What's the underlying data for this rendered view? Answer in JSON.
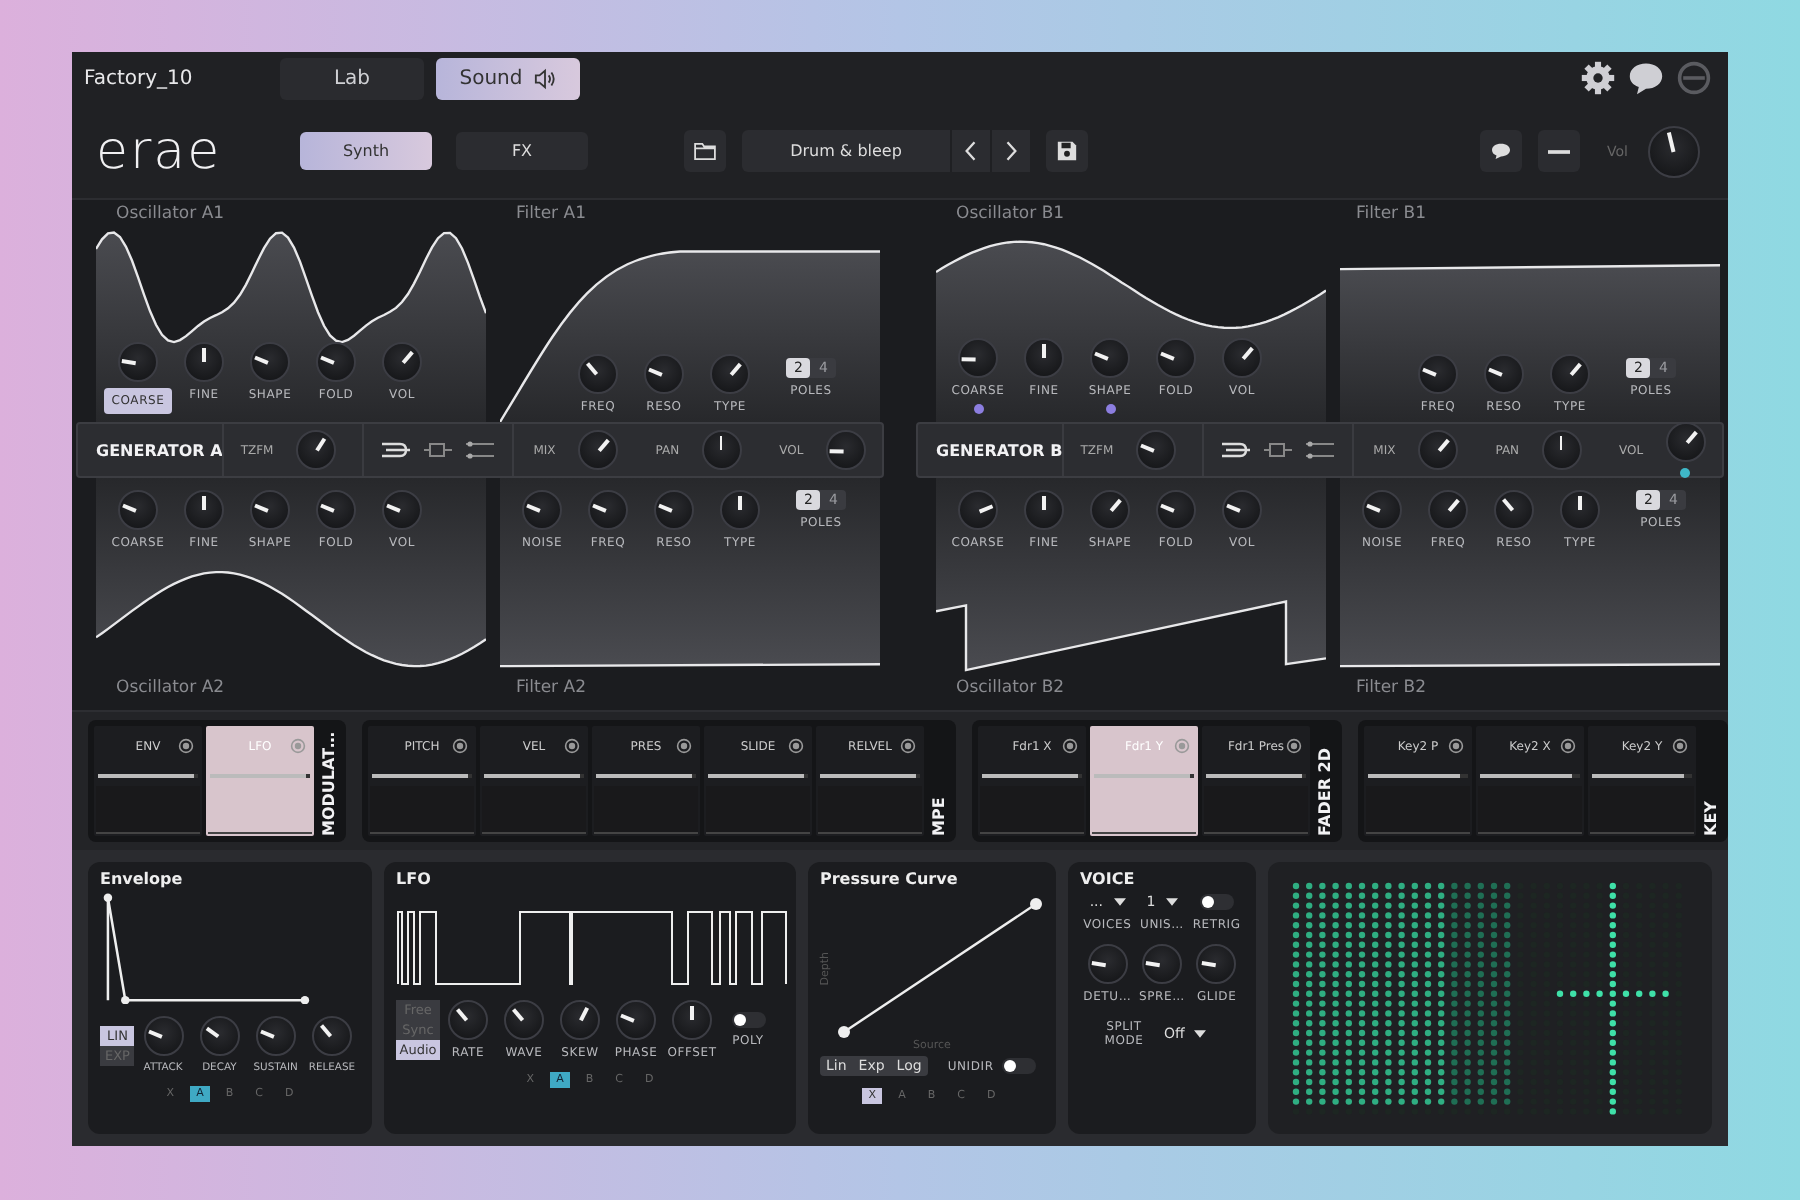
{
  "header": {
    "preset_name": "Factory_10",
    "tabs": [
      {
        "label": "Lab",
        "selected": false
      },
      {
        "label": "Sound",
        "selected": true
      }
    ]
  },
  "toolbar": {
    "logo": "erae",
    "modes": [
      {
        "label": "Synth",
        "selected": true
      },
      {
        "label": "FX",
        "selected": false
      }
    ],
    "preset": "Drum & bleep",
    "vol": {
      "label": "Vol",
      "level": 0.45
    }
  },
  "generators": [
    {
      "name": "GENERATOR A",
      "osc_top": {
        "title": "Oscillator A1",
        "knobs": [
          {
            "label": "COARSE",
            "level": 0.2,
            "selected": true
          },
          {
            "label": "FINE",
            "level": 0.5,
            "selected": false
          },
          {
            "label": "SHAPE",
            "level": 0.25,
            "selected": false
          },
          {
            "label": "FOLD",
            "level": 0.25,
            "selected": false
          },
          {
            "label": "VOL",
            "level": 0.65,
            "selected": false
          }
        ]
      },
      "filter_top": {
        "title": "Filter A1",
        "knobs": [
          {
            "label": "FREQ",
            "level": 0.35
          },
          {
            "label": "RESO",
            "level": 0.25
          },
          {
            "label": "TYPE",
            "level": 0.65
          }
        ],
        "poles": [
          {
            "label": "2",
            "selected": true
          },
          {
            "label": "4",
            "selected": false
          }
        ],
        "poles_label": "POLES"
      },
      "tzfm": {
        "label": "TZFM",
        "level": 0.62
      },
      "mix_knobs": [
        {
          "label": "MIX",
          "level": 0.65
        },
        {
          "label": "PAN",
          "level": 0.5
        },
        {
          "label": "VOL",
          "level": 0.17
        }
      ],
      "osc_bottom": {
        "title": "Oscillator A2",
        "knobs": [
          {
            "label": "COARSE",
            "level": 0.25,
            "selected": false
          },
          {
            "label": "FINE",
            "level": 0.5,
            "selected": false
          },
          {
            "label": "SHAPE",
            "level": 0.25,
            "selected": false
          },
          {
            "label": "FOLD",
            "level": 0.25,
            "selected": false
          },
          {
            "label": "VOL",
            "level": 0.25,
            "selected": false
          }
        ]
      },
      "filter_bottom": {
        "title": "Filter A2",
        "knobs": [
          {
            "label": "NOISE",
            "level": 0.25
          },
          {
            "label": "FREQ",
            "level": 0.25
          },
          {
            "label": "RESO",
            "level": 0.25
          },
          {
            "label": "TYPE",
            "level": 0.5
          }
        ],
        "poles": [
          {
            "label": "2",
            "selected": true
          },
          {
            "label": "4",
            "selected": false
          }
        ],
        "poles_label": "POLES"
      }
    },
    {
      "name": "GENERATOR B",
      "osc_top": {
        "title": "Oscillator B1",
        "knobs": [
          {
            "label": "COARSE",
            "level": 0.17,
            "selected": false,
            "color": "#8c7ee0"
          },
          {
            "label": "FINE",
            "level": 0.5,
            "selected": false
          },
          {
            "label": "SHAPE",
            "level": 0.25,
            "selected": false,
            "color": "#8c7ee0"
          },
          {
            "label": "FOLD",
            "level": 0.25,
            "selected": false
          },
          {
            "label": "VOL",
            "level": 0.65,
            "selected": false
          }
        ]
      },
      "filter_top": {
        "title": "Filter B1",
        "knobs": [
          {
            "label": "FREQ",
            "level": 0.25
          },
          {
            "label": "RESO",
            "level": 0.25
          },
          {
            "label": "TYPE",
            "level": 0.65
          }
        ],
        "poles": [
          {
            "label": "2",
            "selected": true
          },
          {
            "label": "4",
            "selected": false
          }
        ],
        "poles_label": "POLES"
      },
      "tzfm": {
        "label": "TZFM",
        "level": 0.25
      },
      "mix_knobs": [
        {
          "label": "MIX",
          "level": 0.65
        },
        {
          "label": "PAN",
          "level": 0.5
        },
        {
          "label": "VOL",
          "level": 0.65,
          "color": "#3fb8c8"
        }
      ],
      "osc_bottom": {
        "title": "Oscillator B2",
        "knobs": [
          {
            "label": "COARSE",
            "level": 0.75,
            "selected": false
          },
          {
            "label": "FINE",
            "level": 0.5,
            "selected": false
          },
          {
            "label": "SHAPE",
            "level": 0.65,
            "selected": false
          },
          {
            "label": "FOLD",
            "level": 0.25,
            "selected": false
          },
          {
            "label": "VOL",
            "level": 0.25,
            "selected": false
          }
        ]
      },
      "filter_bottom": {
        "title": "Filter B2",
        "knobs": [
          {
            "label": "NOISE",
            "level": 0.25
          },
          {
            "label": "FREQ",
            "level": 0.65
          },
          {
            "label": "RESO",
            "level": 0.35
          },
          {
            "label": "TYPE",
            "level": 0.5
          }
        ],
        "poles": [
          {
            "label": "2",
            "selected": true
          },
          {
            "label": "4",
            "selected": false
          }
        ],
        "poles_label": "POLES"
      }
    }
  ],
  "modulation": [
    {
      "label": "MODULAT…",
      "slots": [
        {
          "label": "ENV",
          "selected": false,
          "level": 0.95
        },
        {
          "label": "LFO",
          "selected": true,
          "level": 0.95
        }
      ]
    },
    {
      "label": "MPE",
      "slots": [
        {
          "label": "PITCH",
          "selected": false,
          "level": 0.95
        },
        {
          "label": "VEL",
          "selected": false,
          "level": 0.95
        },
        {
          "label": "PRES",
          "selected": false,
          "level": 0.95
        },
        {
          "label": "SLIDE",
          "selected": false,
          "level": 0.95
        },
        {
          "label": "RELVEL",
          "selected": false,
          "level": 0.95
        }
      ]
    },
    {
      "label": "FADER 2D",
      "slots": [
        {
          "label": "Fdr1 X",
          "selected": false,
          "level": 0.95
        },
        {
          "label": "Fdr1 Y",
          "selected": true,
          "level": 0.95
        },
        {
          "label": "Fdr1 Pres",
          "selected": false,
          "level": 0.95
        }
      ]
    },
    {
      "label": "KEY",
      "slots": [
        {
          "label": "Key2 P",
          "selected": false,
          "level": 0.92
        },
        {
          "label": "Key2 X",
          "selected": false,
          "level": 0.92
        },
        {
          "label": "Key2 Y",
          "selected": false,
          "level": 0.92
        }
      ]
    }
  ],
  "envelope": {
    "title": "Envelope",
    "modes": [
      {
        "label": "LIN",
        "selected": true
      },
      {
        "label": "EXP",
        "selected": false
      }
    ],
    "knobs": [
      {
        "label": "ATTACK",
        "level": 0.25
      },
      {
        "label": "DECAY",
        "level": 0.3
      },
      {
        "label": "SUSTAIN",
        "level": 0.25
      },
      {
        "label": "RELEASE",
        "level": 0.35
      }
    ],
    "targets": [
      {
        "label": "X",
        "selected": false
      },
      {
        "label": "A",
        "selected": true
      },
      {
        "label": "B",
        "selected": false
      },
      {
        "label": "C",
        "selected": false
      },
      {
        "label": "D",
        "selected": false
      }
    ]
  },
  "lfo": {
    "title": "LFO",
    "modes": [
      {
        "label": "Free",
        "selected": false
      },
      {
        "label": "Sync",
        "selected": false
      },
      {
        "label": "Audio",
        "selected": true
      }
    ],
    "knobs": [
      {
        "label": "RATE",
        "level": 0.35
      },
      {
        "label": "WAVE",
        "level": 0.35
      },
      {
        "label": "SKEW",
        "level": 0.6
      },
      {
        "label": "PHASE",
        "level": 0.25
      },
      {
        "label": "OFFSET",
        "level": 0.5
      }
    ],
    "poly": {
      "label": "POLY",
      "on": false
    },
    "targets": [
      {
        "label": "X",
        "selected": false
      },
      {
        "label": "A",
        "selected": true
      },
      {
        "label": "B",
        "selected": false
      },
      {
        "label": "C",
        "selected": false
      },
      {
        "label": "D",
        "selected": false
      }
    ]
  },
  "pressure_curve": {
    "title": "Pressure Curve",
    "y_axis": "Depth",
    "x_axis": "Source",
    "modes": [
      {
        "label": "Lin",
        "selected": false
      },
      {
        "label": "Exp",
        "selected": false
      },
      {
        "label": "Log",
        "selected": false
      }
    ],
    "unidir": {
      "label": "UNIDIR",
      "on": false
    },
    "targets": [
      {
        "label": "X",
        "selected": true
      },
      {
        "label": "A",
        "selected": false
      },
      {
        "label": "B",
        "selected": false
      },
      {
        "label": "C",
        "selected": false
      },
      {
        "label": "D",
        "selected": false
      }
    ]
  },
  "voice": {
    "title": "VOICE",
    "dropdowns": [
      {
        "value": "...",
        "label": "VOICES"
      },
      {
        "value": "1",
        "label": "UNIS…"
      }
    ],
    "retrig": {
      "label": "RETRIG",
      "on": false
    },
    "knobs": [
      {
        "label": "DETU…",
        "level": 0.2
      },
      {
        "label": "SPRE…",
        "level": 0.2
      },
      {
        "label": "GLIDE",
        "level": 0.2
      }
    ],
    "split": {
      "label": "SPLIT MODE",
      "value": "Off"
    }
  }
}
